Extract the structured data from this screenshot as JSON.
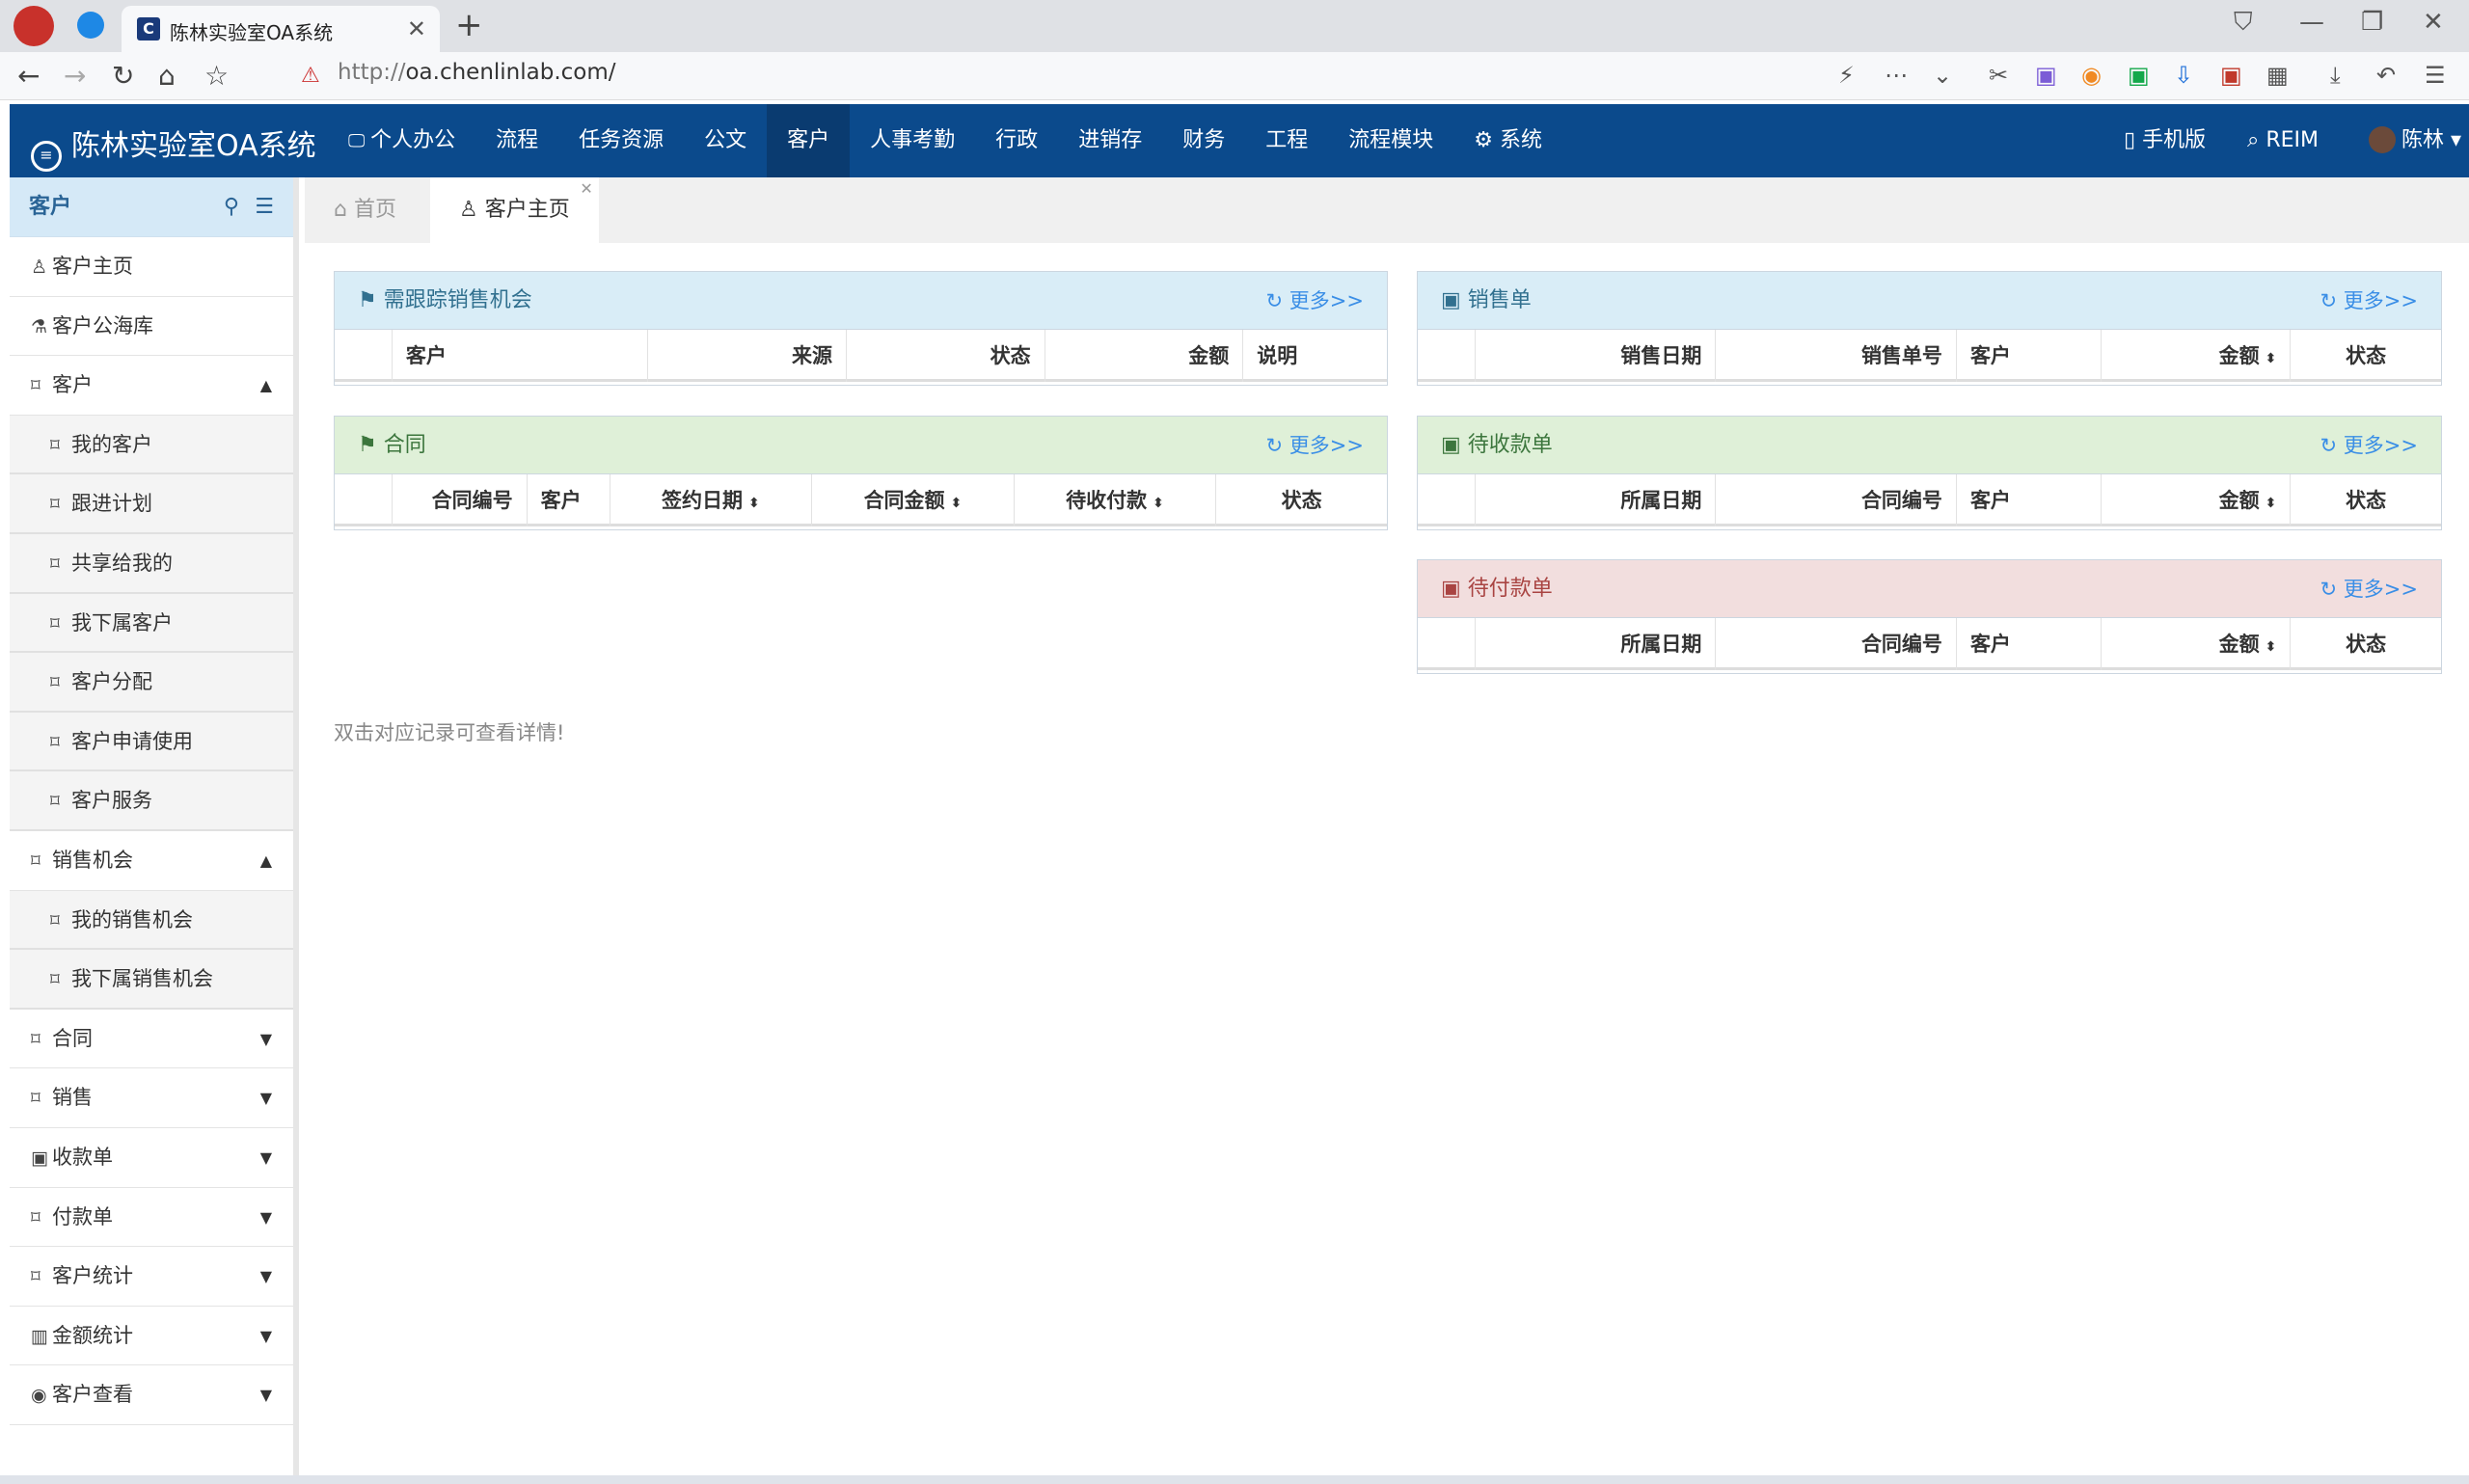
{
  "browser": {
    "tab_title": "陈林实验室OA系统",
    "url_prefix": "http://",
    "url_host": "oa.chenlinlab.com/"
  },
  "navbar": {
    "brand": "陈林实验室OA系统",
    "menu": [
      "个人办公",
      "流程",
      "任务资源",
      "公文",
      "客户",
      "人事考勤",
      "行政",
      "进销存",
      "财务",
      "工程",
      "流程模块",
      "系统"
    ],
    "active_menu": "客户",
    "mobile": "手机版",
    "reim": "REIM",
    "user": "陈林"
  },
  "sidebar": {
    "title": "客户",
    "items": [
      {
        "label": "客户主页",
        "sub": false,
        "icon": "user-icon"
      },
      {
        "label": "客户公海库",
        "sub": false,
        "icon": "flask-icon"
      },
      {
        "label": "客户",
        "sub": false,
        "icon": "bookmark-icon",
        "caret": "up"
      },
      {
        "label": "我的客户",
        "sub": true,
        "icon": "bookmark-icon"
      },
      {
        "label": "跟进计划",
        "sub": true,
        "icon": "bookmark-icon"
      },
      {
        "label": "共享给我的",
        "sub": true,
        "icon": "bookmark-icon"
      },
      {
        "label": "我下属客户",
        "sub": true,
        "icon": "bookmark-icon"
      },
      {
        "label": "客户分配",
        "sub": true,
        "icon": "bookmark-icon"
      },
      {
        "label": "客户申请使用",
        "sub": true,
        "icon": "bookmark-icon"
      },
      {
        "label": "客户服务",
        "sub": true,
        "icon": "bookmark-icon"
      },
      {
        "label": "销售机会",
        "sub": false,
        "icon": "bookmark-icon",
        "caret": "up"
      },
      {
        "label": "我的销售机会",
        "sub": true,
        "icon": "bookmark-icon"
      },
      {
        "label": "我下属销售机会",
        "sub": true,
        "icon": "bookmark-icon"
      },
      {
        "label": "合同",
        "sub": false,
        "icon": "bookmark-icon",
        "caret": "down"
      },
      {
        "label": "销售",
        "sub": false,
        "icon": "bookmark-icon",
        "caret": "down"
      },
      {
        "label": "收款单",
        "sub": false,
        "icon": "money-icon",
        "caret": "down"
      },
      {
        "label": "付款单",
        "sub": false,
        "icon": "bookmark-icon",
        "caret": "down"
      },
      {
        "label": "客户统计",
        "sub": false,
        "icon": "bookmark-icon",
        "caret": "down"
      },
      {
        "label": "金额统计",
        "sub": false,
        "icon": "bar-chart-icon",
        "caret": "down"
      },
      {
        "label": "客户查看",
        "sub": false,
        "icon": "eye-icon",
        "caret": "down"
      }
    ]
  },
  "content_tabs": {
    "home": "首页",
    "current": "客户主页"
  },
  "more_label": "更多>>",
  "panels": {
    "followup": {
      "title": "需跟踪销售机会",
      "cols": [
        "",
        "客户",
        "来源",
        "状态",
        "金额",
        "说明"
      ]
    },
    "contract": {
      "title": "合同",
      "cols": [
        "",
        "合同编号",
        "客户",
        "签约日期",
        "合同金额",
        "待收付款",
        "状态"
      ]
    },
    "sales": {
      "title": "销售单",
      "cols": [
        "",
        "销售日期",
        "销售单号",
        "客户",
        "金额",
        "状态"
      ]
    },
    "receivable": {
      "title": "待收款单",
      "cols": [
        "",
        "所属日期",
        "合同编号",
        "客户",
        "金额",
        "状态"
      ]
    },
    "payable": {
      "title": "待付款单",
      "cols": [
        "",
        "所属日期",
        "合同编号",
        "客户",
        "金额",
        "状态"
      ]
    }
  },
  "hint": "双击对应记录可查看详情!"
}
